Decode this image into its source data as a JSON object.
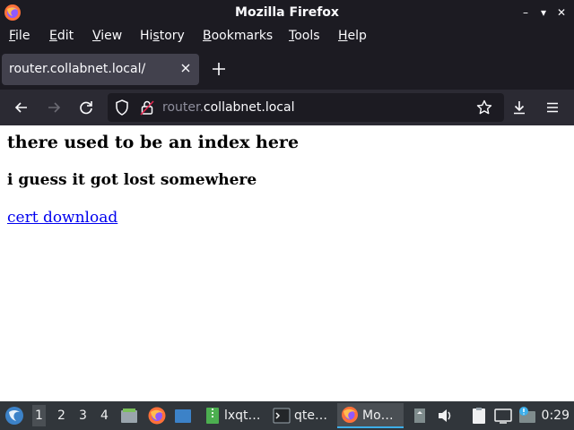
{
  "window": {
    "title": "Mozilla Firefox",
    "controls": {
      "minimize": "–",
      "restore": "▾",
      "close": "✕"
    }
  },
  "menubar": {
    "items": [
      {
        "pre": "",
        "key": "F",
        "post": "ile"
      },
      {
        "pre": "",
        "key": "E",
        "post": "dit"
      },
      {
        "pre": "",
        "key": "V",
        "post": "iew"
      },
      {
        "pre": "Hi",
        "key": "s",
        "post": "tory"
      },
      {
        "pre": "",
        "key": "B",
        "post": "ookmarks"
      },
      {
        "pre": "",
        "key": "T",
        "post": "ools"
      },
      {
        "pre": "",
        "key": "H",
        "post": "elp"
      }
    ]
  },
  "tabs": [
    {
      "title": "router.collabnet.local/"
    }
  ],
  "urlbar": {
    "subdomain": "router.",
    "host": "collabnet.local"
  },
  "page": {
    "heading": "there used to be an index here",
    "subheading": "i guess it got lost somewhere",
    "link_text": "cert download"
  },
  "taskbar": {
    "desktops": [
      "1",
      "2",
      "3",
      "4"
    ],
    "active_desktop": "1",
    "tasks": [
      {
        "label": "lxqt…",
        "icon": "zip-archive-icon"
      },
      {
        "label": "qte…",
        "icon": "terminal-icon"
      },
      {
        "label": "Mo…",
        "icon": "firefox-icon"
      }
    ],
    "clock": "0:29"
  },
  "colors": {
    "chrome_dark": "#1c1b22",
    "toolbar": "#2b2a33",
    "tab_selected": "#42414d",
    "link": "#0000ee",
    "taskbar": "#31363b",
    "taskbar_accent": "#3daee9"
  }
}
